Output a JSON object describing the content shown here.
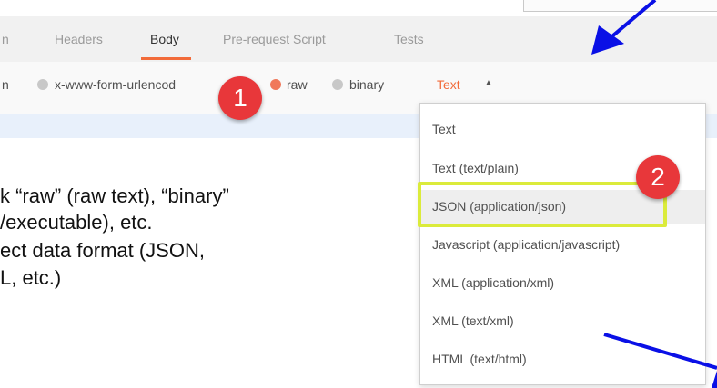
{
  "tabs": {
    "partial_left": "n",
    "headers": "Headers",
    "body": "Body",
    "prerequest": "Pre-request Script",
    "tests": "Tests"
  },
  "body_types": {
    "partial_left": "n",
    "urlencoded": "x-www-form-urlencod",
    "raw": "raw",
    "binary": "binary",
    "format_selected": "Text",
    "format_caret": "▲"
  },
  "explanation": {
    "line1": "k “raw” (raw text), “binary”",
    "line2": "/executable), etc.",
    "line3": "ect data format (JSON,",
    "line4": "L, etc.)"
  },
  "dropdown": {
    "items": [
      "Text",
      "Text (text/plain)",
      "JSON (application/json)",
      "Javascript (application/javascript)",
      "XML (application/xml)",
      "XML (text/xml)",
      "HTML (text/html)"
    ]
  },
  "callouts": {
    "first": "1",
    "second": "2"
  },
  "colors": {
    "accent": "#f26b3a",
    "callout": "#e8373a",
    "highlight": "#dbeb3b",
    "arrow": "#0a10e6",
    "radio_active": "#f0785a"
  }
}
